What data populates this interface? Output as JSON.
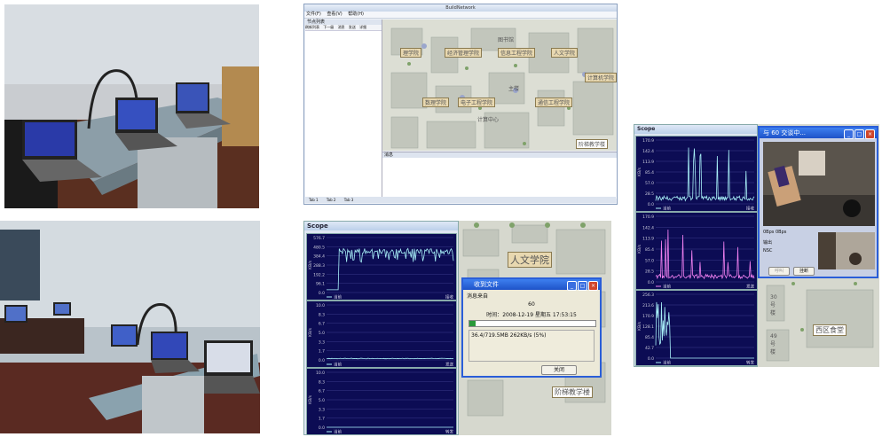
{
  "photos": [
    {
      "name": "lab-photo-1"
    },
    {
      "name": "lab-photo-2"
    }
  ],
  "app_window": {
    "title": "BuildNetwork",
    "menus": [
      "文件(F)",
      "查看(V)",
      "帮助(H)"
    ],
    "left_pane_title": "节点列表",
    "left_toolbar": [
      "刷新列表",
      "下一级",
      "消息",
      "发送",
      "详细"
    ],
    "log_pane_title": "消息",
    "bottom_tabs": [
      "Tab 1",
      "Tab 2",
      "Tab 3"
    ],
    "map_labels": [
      "人文学院",
      "经济管理学院",
      "理学院",
      "电子工程学院",
      "信息工程学院",
      "数理学院",
      "计算机学院",
      "通信工程学院",
      "主楼",
      "图书馆",
      "计算中心",
      "阶梯教学楼"
    ]
  },
  "scope_mid": {
    "title": "Scope",
    "plot1": {
      "yunit": "KB/s",
      "ticks": [
        "576.7",
        "480.5",
        "384.4",
        "288.3",
        "192.2",
        "96.1",
        "0.0"
      ],
      "legend": "当前",
      "xlabel": "接收"
    },
    "plot2": {
      "yunit": "KB/s",
      "ticks": [
        "10.0",
        "8.3",
        "6.7",
        "5.0",
        "3.3",
        "1.7",
        "0.0"
      ],
      "legend": "当前",
      "xlabel": "发送"
    },
    "plot3": {
      "yunit": "KB/s",
      "ticks": [
        "10.0",
        "8.3",
        "6.7",
        "5.0",
        "3.3",
        "1.7",
        "0.0"
      ],
      "legend": "当前",
      "xlabel": "转发"
    },
    "map_labels": [
      "人文学院",
      "阶梯教学楼"
    ]
  },
  "file_dialog": {
    "title": "收到文件",
    "section": "消息来自",
    "sender": "60",
    "time_label": "时间：",
    "time_value": "2008-12-19 星期五 17:53:15",
    "progress_text": "36.4/719.5MB 262KB/s (5%)",
    "progress_fraction": 0.05,
    "close_label": "关闭"
  },
  "scope_right": {
    "title": "Scope",
    "plot1": {
      "yunit": "KB/s",
      "ticks": [
        "170.9",
        "142.4",
        "113.9",
        "85.4",
        "57.0",
        "28.5",
        "0.0"
      ],
      "legend": "当前",
      "xlabel": "接收"
    },
    "plot2": {
      "yunit": "KB/s",
      "ticks": [
        "170.9",
        "142.4",
        "113.9",
        "85.4",
        "57.0",
        "28.5",
        "0.0"
      ],
      "legend": "当前",
      "xlabel": "发送"
    },
    "plot3": {
      "yunit": "KB/s",
      "ticks": [
        "256.3",
        "213.6",
        "170.9",
        "128.1",
        "85.4",
        "42.7",
        "0.0"
      ],
      "legend": "当前",
      "xlabel": "转发"
    }
  },
  "video_dialog": {
    "title": "与 60 交谈中...",
    "rate": "0Bps 0Bps",
    "field1": "输出",
    "field2": "NSC",
    "btn_disabled": "呼叫",
    "btn_hangup": "挂断"
  },
  "map_right": {
    "labels": [
      "西区食堂",
      "30号楼",
      "49号楼"
    ]
  },
  "colors": {
    "scope_bg": "#0c0c54",
    "trace_cyan": "#a8f0f8",
    "trace_pink": "#f080f0",
    "dialog_blue": "#1e52c8"
  }
}
